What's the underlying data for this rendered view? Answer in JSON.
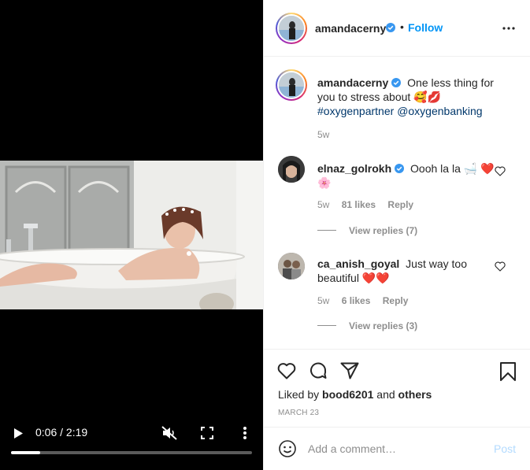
{
  "video": {
    "time": "0:06 / 2:19",
    "progress_fraction": 0.12
  },
  "header": {
    "username": "amandacerny",
    "separator": "•",
    "follow_label": "Follow"
  },
  "caption": {
    "username": "amandacerny",
    "text": "One less thing for you to stress about 🥰💋",
    "hashtag": "#oxygenpartner",
    "mention": "@oxygenbanking",
    "time": "5w"
  },
  "comments": [
    {
      "username": "elnaz_golrokh",
      "verified": true,
      "text": "Oooh la la 🛁 ❤️🌸",
      "time": "5w",
      "likes": "81 likes",
      "reply_label": "Reply",
      "view_replies": "View replies (7)"
    },
    {
      "username": "ca_anish_goyal",
      "verified": false,
      "text": "Just way too beautiful ❤️❤️",
      "time": "5w",
      "likes": "6 likes",
      "reply_label": "Reply",
      "view_replies": "View replies (3)"
    }
  ],
  "likes": {
    "prefix": "Liked by",
    "user": "bood6201",
    "conjunction": "and",
    "others": "others"
  },
  "date": "MARCH 23",
  "add_comment": {
    "placeholder": "Add a comment…",
    "post_label": "Post"
  },
  "colors": {
    "accent": "#0095f6",
    "link": "#00376b",
    "muted": "#8e8e8e",
    "heart_red": "#ed4956",
    "post_disabled": "#b3dbff"
  }
}
